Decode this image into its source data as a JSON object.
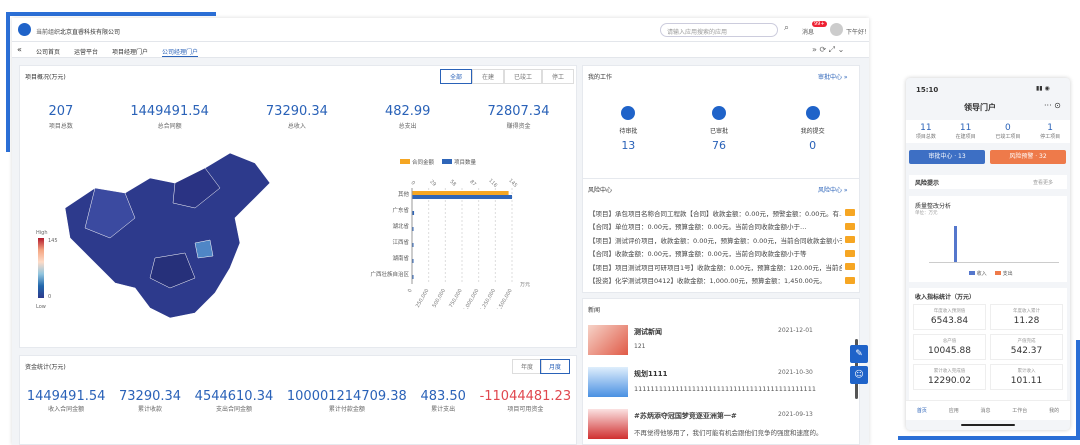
{
  "header": {
    "org_label": "当前组织：",
    "org_name": "北京直睿科技有限公司",
    "search_placeholder": "请输入应用搜索的应用",
    "message_label": "消息",
    "message_badge": "99+",
    "greeting": "下午好！测试0001"
  },
  "tabs": [
    "公司首页",
    "运营平台",
    "项目经理门户",
    "公司经理门户"
  ],
  "project_overview": {
    "title": "项目概况(万元)",
    "filters": [
      "全部",
      "在建",
      "已竣工",
      "停工"
    ],
    "stats": [
      {
        "value": "207",
        "label": "项目总数"
      },
      {
        "value": "1449491.54",
        "label": "总合同额"
      },
      {
        "value": "73290.34",
        "label": "总收入"
      },
      {
        "value": "482.99",
        "label": "总支出"
      },
      {
        "value": "72807.34",
        "label": "赚得资金"
      }
    ],
    "legend": [
      "合同金额",
      "项目数量"
    ],
    "map_legend_high": "High",
    "map_legend_low": "Low",
    "map_legend_max": "145",
    "map_legend_min": "0",
    "bar_axis_unit": "万元"
  },
  "chart_data": {
    "type": "bar",
    "categories": [
      "其他",
      "广东省",
      "湖北省",
      "江西省",
      "湖南省",
      "广西壮族自治区"
    ],
    "series": [
      {
        "name": "合同金额",
        "values": [
          1449000,
          0,
          0,
          0,
          0,
          0
        ]
      },
      {
        "name": "项目数量",
        "values": [
          145,
          3,
          2,
          2,
          2,
          1
        ]
      }
    ],
    "x_ticks": [
      "0",
      "250,000",
      "500,000",
      "750,000",
      "1,000,000",
      "1,250,000",
      "1,500,000"
    ],
    "y_ticks": [
      "0",
      "29",
      "58",
      "87",
      "116",
      "145"
    ]
  },
  "work": {
    "title": "我的工作",
    "link": "审批中心 »",
    "items": [
      {
        "label": "待审批",
        "value": "13"
      },
      {
        "label": "已审批",
        "value": "76"
      },
      {
        "label": "我的提交",
        "value": "0"
      }
    ]
  },
  "warning": {
    "title": "风险中心",
    "link": "风险中心 »",
    "rows": [
      "【项目】承包项目名称合同工程款【合同】收款金额：0.00元，预警金额：0.00元。有…",
      "【合同】单位项目：0.00元，预算金额：0.00元。当前合同收款金额小于…",
      "【项目】测试评价项目，收款金额：0.00元，预算金额：0.00元，当前合同收款金额小于…",
      "【合同】收款金额：0.00元，预算金额：0.00元，当前合同收款金额小于等",
      "【项目】项目测试项目可研项目1号】收款金额：0.00元，预算金额：120.00元，当前合",
      "【投资】化学测试项目0412】收款金额：1,000.00元，预算金额：1,450.00元。"
    ]
  },
  "news": {
    "title": "新闻",
    "items": [
      {
        "title": "测试新闻",
        "date": "2021-12-01",
        "desc": "121"
      },
      {
        "title": "规划1111",
        "date": "2021-10-30",
        "desc": "11111111111111111111111111111111111111111111"
      },
      {
        "title": "#苏炳添夺冠国梦竞逐亚洲第一#",
        "date": "2021-09-13",
        "desc": "不再觉得他够用了，我们可能有机会跟他们竞争的强度和速度的。"
      }
    ]
  },
  "funds": {
    "title": "资金统计(万元)",
    "filters": [
      "年度",
      "月度"
    ],
    "stats": [
      {
        "value": "1449491.54",
        "label": "收入合同金额"
      },
      {
        "value": "73290.34",
        "label": "累计收款"
      },
      {
        "value": "4544610.34",
        "label": "支出合同金额"
      },
      {
        "value": "100001214709.38",
        "label": "累计付款金额"
      },
      {
        "value": "483.50",
        "label": "累计支出"
      },
      {
        "value": "-11044481.23",
        "label": "项目可用资金"
      }
    ]
  },
  "mobile": {
    "time": "15:10",
    "title": "领导门户",
    "stats": [
      {
        "value": "11",
        "label": "项目总数"
      },
      {
        "value": "11",
        "label": "在建项目"
      },
      {
        "value": "0",
        "label": "已竣工项目"
      },
      {
        "value": "1",
        "label": "停工项目"
      }
    ],
    "btn_approve": "审批中心 · 13",
    "btn_risk": "风险预警 · 32",
    "risk_title": "风险提示",
    "risk_more": "查看更多",
    "chart_title": "质量整改分析",
    "chart_unit": "单位：万元",
    "legend": [
      "收入",
      "支出"
    ],
    "income_title": "收入指标统计（万元）",
    "cells": [
      {
        "label": "年度收入预测值",
        "value": "6543.84"
      },
      {
        "label": "年度收入累计",
        "value": "11.28"
      },
      {
        "label": "总产值",
        "value": "10045.88"
      },
      {
        "label": "产值完成",
        "value": "542.37"
      },
      {
        "label": "累计收入完成值",
        "value": "12290.02"
      },
      {
        "label": "累计收入",
        "value": "101.11"
      }
    ],
    "nav": [
      "首页",
      "应用",
      "消息",
      "工作台",
      "我的"
    ]
  }
}
